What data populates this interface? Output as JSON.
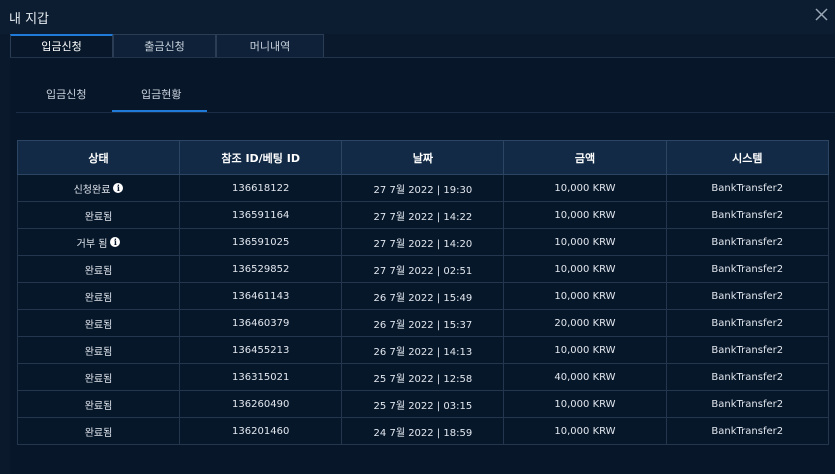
{
  "window": {
    "title": "내 지갑"
  },
  "tabs": [
    {
      "label": "입금신청",
      "active": true
    },
    {
      "label": "출금신청",
      "active": false
    },
    {
      "label": "머니내역",
      "active": false
    }
  ],
  "subtabs": [
    {
      "label": "입금신청",
      "active": false
    },
    {
      "label": "입금현황",
      "active": true
    }
  ],
  "table": {
    "headers": [
      "상태",
      "참조 ID/베팅 ID",
      "날짜",
      "금액",
      "시스템"
    ],
    "rows": [
      {
        "status": "신청완료",
        "info": true,
        "id": "136618122",
        "date": "27 7월 2022 | 19:30",
        "amount": "10,000 KRW",
        "system": "BankTransfer2"
      },
      {
        "status": "완료됨",
        "info": false,
        "id": "136591164",
        "date": "27 7월 2022 | 14:22",
        "amount": "10,000 KRW",
        "system": "BankTransfer2"
      },
      {
        "status": "거부 됨",
        "info": true,
        "id": "136591025",
        "date": "27 7월 2022 | 14:20",
        "amount": "10,000 KRW",
        "system": "BankTransfer2"
      },
      {
        "status": "완료됨",
        "info": false,
        "id": "136529852",
        "date": "27 7월 2022 | 02:51",
        "amount": "10,000 KRW",
        "system": "BankTransfer2"
      },
      {
        "status": "완료됨",
        "info": false,
        "id": "136461143",
        "date": "26 7월 2022 | 15:49",
        "amount": "10,000 KRW",
        "system": "BankTransfer2"
      },
      {
        "status": "완료됨",
        "info": false,
        "id": "136460379",
        "date": "26 7월 2022 | 15:37",
        "amount": "20,000 KRW",
        "system": "BankTransfer2"
      },
      {
        "status": "완료됨",
        "info": false,
        "id": "136455213",
        "date": "26 7월 2022 | 14:13",
        "amount": "10,000 KRW",
        "system": "BankTransfer2"
      },
      {
        "status": "완료됨",
        "info": false,
        "id": "136315021",
        "date": "25 7월 2022 | 12:58",
        "amount": "40,000 KRW",
        "system": "BankTransfer2"
      },
      {
        "status": "완료됨",
        "info": false,
        "id": "136260490",
        "date": "25 7월 2022 | 03:15",
        "amount": "10,000 KRW",
        "system": "BankTransfer2"
      },
      {
        "status": "완료됨",
        "info": false,
        "id": "136201460",
        "date": "24 7월 2022 | 18:59",
        "amount": "10,000 KRW",
        "system": "BankTransfer2"
      }
    ]
  },
  "icons": {
    "close": "close-icon",
    "info": "info-icon"
  },
  "colors": {
    "background": "#0a1a2c",
    "accent": "#1f7ad8",
    "header": "#122a45"
  }
}
